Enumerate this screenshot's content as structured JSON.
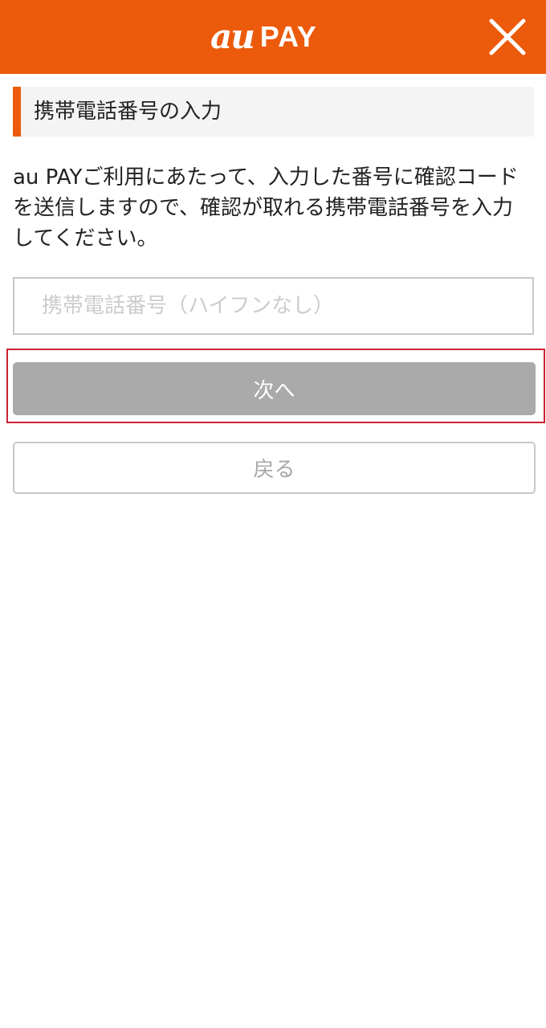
{
  "header": {
    "logo_au": "au",
    "logo_pay": "PAY",
    "close_icon": "close-icon",
    "bg_color": "#ec5a0b"
  },
  "section": {
    "title": "携帯電話番号の入力",
    "accent_color": "#ec5a0b"
  },
  "description": "au PAYご利用にあたって、入力した番号に確認コードを送信しますので、確認が取れる携帯電話番号を入力してください。",
  "phone_input": {
    "value": "",
    "placeholder": "携帯電話番号（ハイフンなし）"
  },
  "buttons": {
    "next_label": "次へ",
    "back_label": "戻る"
  },
  "colors": {
    "highlight_border": "#cc2233",
    "next_disabled_bg": "#aaaaaa"
  }
}
